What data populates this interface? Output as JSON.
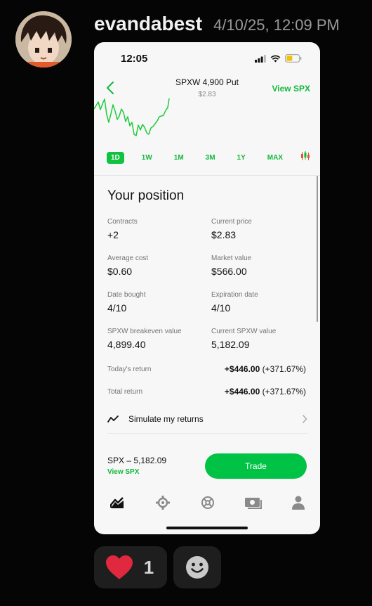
{
  "message": {
    "username": "evandabest",
    "timestamp": "4/10/25, 12:09 PM"
  },
  "phone": {
    "status_time": "12:05",
    "header": {
      "title": "SPXW 4,900 Put",
      "subtitle": "$2.83",
      "view_link": "View SPX"
    },
    "ranges": [
      "1D",
      "1W",
      "1M",
      "3M",
      "1Y",
      "MAX"
    ],
    "active_range": "1D",
    "position": {
      "title": "Your position",
      "contracts_label": "Contracts",
      "contracts_value": "+2",
      "current_price_label": "Current price",
      "current_price_value": "$2.83",
      "avg_cost_label": "Average cost",
      "avg_cost_value": "$0.60",
      "market_value_label": "Market value",
      "market_value_value": "$566.00",
      "date_bought_label": "Date bought",
      "date_bought_value": "4/10",
      "expiration_label": "Expiration date",
      "expiration_value": "4/10",
      "breakeven_label": "SPXW breakeven value",
      "breakeven_value": "4,899.40",
      "current_spxw_label": "Current SPXW value",
      "current_spxw_value": "5,182.09",
      "todays_return_label": "Today's return",
      "todays_return_amount": "+$446.00",
      "todays_return_pct": "(+371.67%)",
      "total_return_label": "Total return",
      "total_return_amount": "+$446.00",
      "total_return_pct": "(+371.67%)"
    },
    "simulate_label": "Simulate my returns",
    "footer": {
      "spx_line": "SPX – 5,182.09",
      "spx_link": "View SPX",
      "trade_label": "Trade"
    },
    "tabs": [
      "chart-icon",
      "compass-icon",
      "crypto-icon",
      "cash-icon",
      "profile-icon"
    ]
  },
  "reactions": {
    "heart_count": "1"
  },
  "colors": {
    "accent_green": "#00c244",
    "background": "#050505"
  }
}
